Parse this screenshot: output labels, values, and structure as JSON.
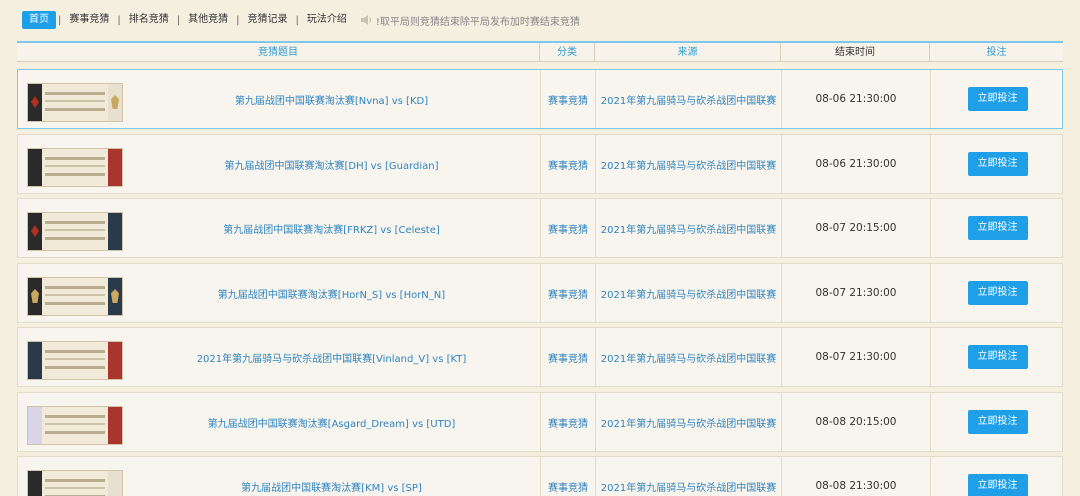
{
  "nav": {
    "tabs": [
      "首页",
      "赛事竞猜",
      "排名竞猜",
      "其他竞猜",
      "竞猜记录",
      "玩法介绍"
    ],
    "notice": "!取平局则竞猜结束除平局发布加时赛结束竞猜",
    "speaker_icon": "speaker-icon"
  },
  "table": {
    "headers": {
      "title": "竞猜题目",
      "category": "分类",
      "source": "来源",
      "end_time": "结束时间",
      "bet": "投注"
    },
    "rows": [
      {
        "title": "第九届战团中国联赛淘汰赛[Nvna] vs [KD]",
        "category": "赛事竞猜",
        "source": "2021年第九届骑马与砍杀战团中国联赛",
        "end_time": "08-06 21:30:00",
        "button": "立即投注"
      },
      {
        "title": "第九届战团中国联赛淘汰赛[DH] vs [Guardian]",
        "category": "赛事竞猜",
        "source": "2021年第九届骑马与砍杀战团中国联赛",
        "end_time": "08-06 21:30:00",
        "button": "立即投注"
      },
      {
        "title": "第九届战团中国联赛淘汰赛[FRKZ] vs [Celeste]",
        "category": "赛事竞猜",
        "source": "2021年第九届骑马与砍杀战团中国联赛",
        "end_time": "08-07 20:15:00",
        "button": "立即投注"
      },
      {
        "title": "第九届战团中国联赛淘汰赛[HorN_S] vs [HorN_N]",
        "category": "赛事竞猜",
        "source": "2021年第九届骑马与砍杀战团中国联赛",
        "end_time": "08-07 21:30:00",
        "button": "立即投注"
      },
      {
        "title": "2021年第九届骑马与砍杀战团中国联赛[Vinland_V] vs [KT]",
        "category": "赛事竞猜",
        "source": "2021年第九届骑马与砍杀战团中国联赛",
        "end_time": "08-07 21:30:00",
        "button": "立即投注"
      },
      {
        "title": "第九届战团中国联赛淘汰赛[Asgard_Dream] vs [UTD]",
        "category": "赛事竞猜",
        "source": "2021年第九届骑马与砍杀战团中国联赛",
        "end_time": "08-08 20:15:00",
        "button": "立即投注"
      },
      {
        "title": "第九届战团中国联赛淘汰赛[KM] vs [SP]",
        "category": "赛事竞猜",
        "source": "2021年第九届骑马与砍杀战团中国联赛",
        "end_time": "08-08 21:30:00",
        "button": "立即投注"
      }
    ]
  }
}
